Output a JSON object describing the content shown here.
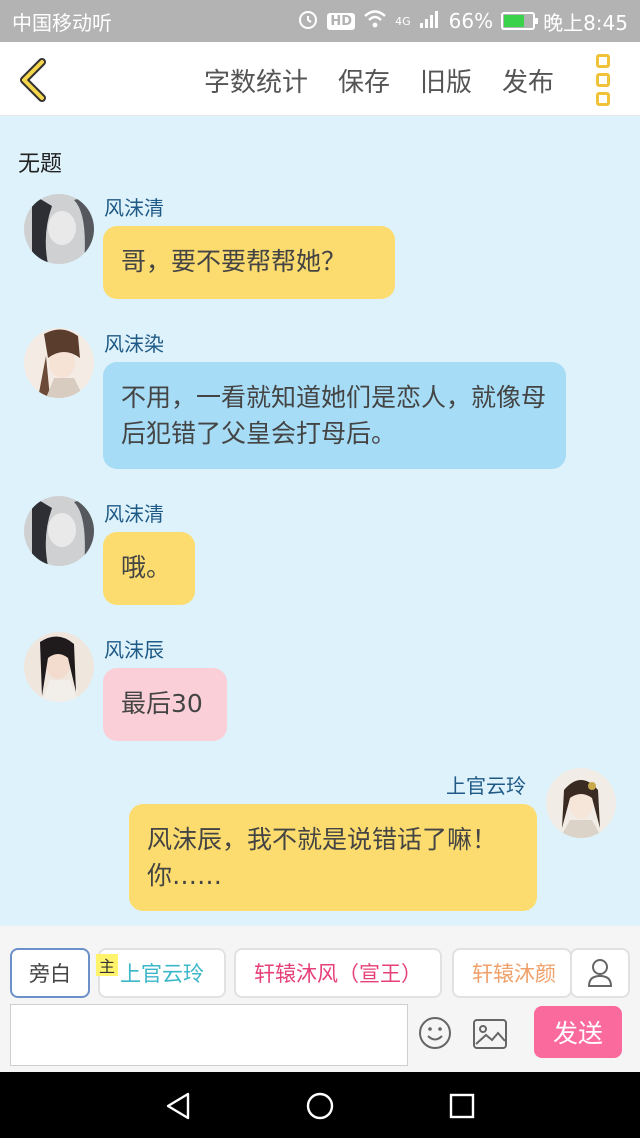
{
  "status_bar": {
    "carrier": "中国移动",
    "carrier_extra": "听",
    "hd": "HD",
    "network": "4G",
    "battery": "66%",
    "time": "晚上8:45"
  },
  "toolbar": {
    "actions": [
      "字数统计",
      "保存",
      "旧版",
      "发布"
    ]
  },
  "chat": {
    "title": "无题",
    "messages": [
      {
        "name": "风沫清",
        "text": "哥，要不要帮帮她？",
        "color": "#fcdc6e"
      },
      {
        "name": "风沫染",
        "text": "不用，一看就知道她们是恋人，就像母后犯错了父皇会打母后。",
        "color": "#a6dcf5"
      },
      {
        "name": "风沫清",
        "text": "哦。",
        "color": "#fcdc6e"
      },
      {
        "name": "风沫辰",
        "text": "最后30",
        "color": "#fbcfd8"
      },
      {
        "name": "上官云玲",
        "text": "风沫辰，我不就是说错话了嘛！你……",
        "color": "#fcdc6e"
      }
    ]
  },
  "roles": {
    "narration": "旁白",
    "main_badge": "主",
    "items": [
      {
        "label": "上官云玲",
        "color": "#3cb6c9"
      },
      {
        "label": "轩辕沐风（宣王）",
        "color": "#e6407a"
      },
      {
        "label": "轩辕沐颜（",
        "color": "#f0a06a"
      }
    ]
  },
  "composer": {
    "placeholder": "",
    "send_label": "发送"
  },
  "colors": {
    "accent": "#f0c23a",
    "send": "#fb6a9d",
    "chat_bg": "#def2fb"
  }
}
